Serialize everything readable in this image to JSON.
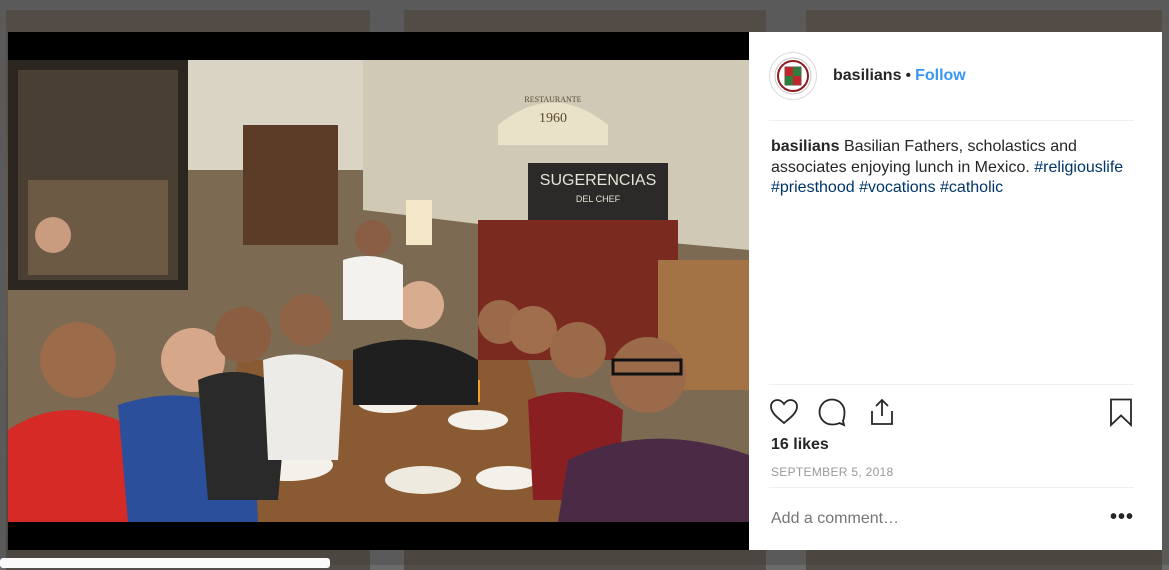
{
  "post": {
    "username": "basilians",
    "separator": "•",
    "follow_label": "Follow",
    "caption": {
      "username": "basilians",
      "text": "Basilian Fathers, scholastics and associates enjoying lunch in Mexico.",
      "hashtags": [
        "#religiouslife",
        "#priesthood",
        "#vocations",
        "#catholic"
      ]
    },
    "likes": "16 likes",
    "date": "SEPTEMBER 5, 2018",
    "comment_placeholder": "Add a comment…",
    "more_label": "•••"
  },
  "photo": {
    "signs": {
      "sugerencias": "SUGERENCIAS",
      "del_chef": "DEL CHEF",
      "restaurante": "RESTAURANTE",
      "year": "1960"
    }
  },
  "icons": {
    "like": "heart-icon",
    "comment": "comment-icon",
    "share": "share-icon",
    "save": "bookmark-icon"
  },
  "colors": {
    "link": "#3897f0",
    "hashtag": "#003569",
    "text": "#262626",
    "muted": "#999999"
  }
}
